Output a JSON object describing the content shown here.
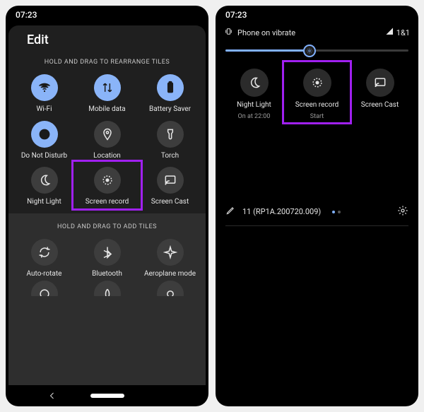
{
  "left": {
    "status_time": "07:23",
    "header": {
      "title": "Edit"
    },
    "hint_rearrange": "HOLD AND DRAG TO REARRANGE TILES",
    "hint_add": "HOLD AND DRAG TO ADD TILES",
    "tiles": [
      {
        "label": "Wi-Fi",
        "icon": "wifi-icon",
        "active": true
      },
      {
        "label": "Mobile data",
        "icon": "swap-icon",
        "active": true
      },
      {
        "label": "Battery Saver",
        "icon": "battery-icon",
        "active": true
      },
      {
        "label": "Do Not Disturb",
        "icon": "dnd-icon",
        "active": true
      },
      {
        "label": "Location",
        "icon": "location-icon",
        "active": false
      },
      {
        "label": "Torch",
        "icon": "torch-icon",
        "active": false
      },
      {
        "label": "Night Light",
        "icon": "moon-icon",
        "active": false
      },
      {
        "label": "Screen record",
        "icon": "record-icon",
        "active": false,
        "highlight": true
      },
      {
        "label": "Screen Cast",
        "icon": "cast-icon",
        "active": false
      }
    ],
    "add_tiles": [
      {
        "label": "Auto-rotate",
        "icon": "rotate-icon"
      },
      {
        "label": "Bluetooth",
        "icon": "bluetooth-icon"
      },
      {
        "label": "Aeroplane mode",
        "icon": "airplane-icon"
      }
    ]
  },
  "right": {
    "status_time": "07:23",
    "vibrate_text": "Phone on vibrate",
    "carrier": "1&1",
    "brightness_pct": 46,
    "tiles": [
      {
        "label": "Night Light",
        "sub": "On at 22:00",
        "icon": "moon-icon"
      },
      {
        "label": "Screen record",
        "sub": "Start",
        "icon": "record-icon",
        "highlight": true
      },
      {
        "label": "Screen Cast",
        "sub": "",
        "icon": "cast-icon"
      }
    ],
    "build": "11 (RP1A.200720.009)"
  },
  "colors": {
    "highlight": "#a020f0",
    "accent": "#8ab4f8",
    "slider": "#81b1ff"
  }
}
